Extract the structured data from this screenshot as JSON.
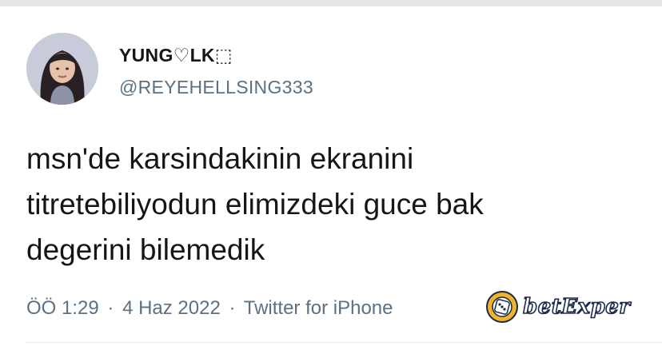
{
  "tweet": {
    "display_name": "YUNG♡LK⬚",
    "handle": "@REYEHELLSING333",
    "text_lines": [
      "msn'de karsindakinin ekranini",
      "titretebiliyodun elimizdeki guce bak",
      "degerini bilemedik"
    ],
    "time": "ÖÖ 1:29",
    "date": "4 Haz 2022",
    "source": "Twitter for iPhone",
    "separator": "·"
  },
  "watermark": {
    "text": "betExper",
    "icon": "dice-chip-icon"
  },
  "colors": {
    "primary_text": "#14171a",
    "secondary_text": "#5b7083",
    "divider": "#e6ecf0"
  }
}
